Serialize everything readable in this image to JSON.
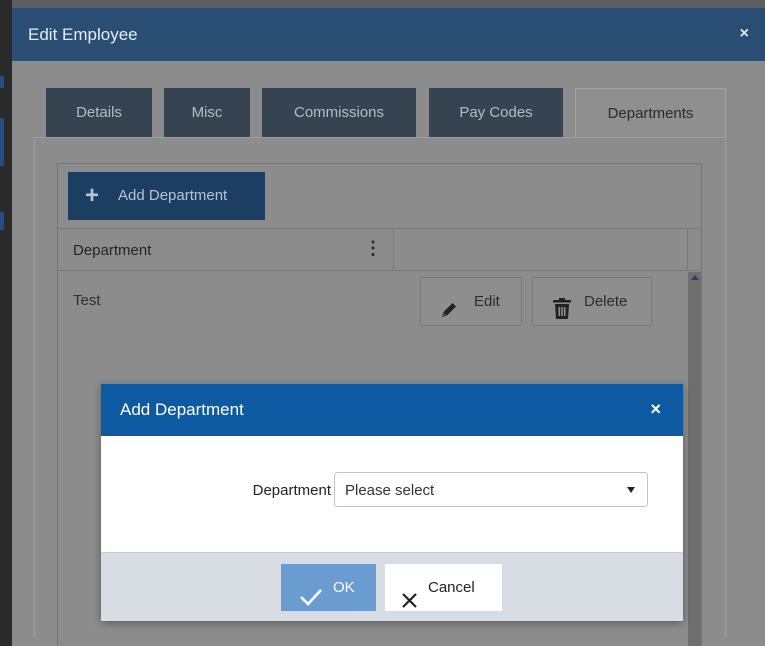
{
  "outer_dialog": {
    "title": "Edit Employee",
    "close_glyph": "×",
    "tabs": [
      {
        "label": "Details",
        "active": false
      },
      {
        "label": "Misc",
        "active": false
      },
      {
        "label": "Commissions",
        "active": false
      },
      {
        "label": "Pay Codes",
        "active": false
      },
      {
        "label": "Departments",
        "active": true
      }
    ]
  },
  "toolbar": {
    "add_label": "Add Department",
    "add_icon": "plus-icon"
  },
  "table": {
    "columns": [
      {
        "label": "Department",
        "has_menu": true
      },
      {
        "label": ""
      }
    ],
    "column_menu_glyph": "⋮",
    "rows": [
      {
        "department": "Test",
        "actions": [
          {
            "label": "Edit",
            "icon": "pencil-icon"
          },
          {
            "label": "Delete",
            "icon": "trash-icon"
          }
        ]
      }
    ]
  },
  "modal": {
    "title": "Add Department",
    "close_glyph": "×",
    "field": {
      "label": "Department",
      "required": true,
      "value": "Please select"
    },
    "ok_label": "OK",
    "cancel_label": "Cancel"
  },
  "colors": {
    "outer_header": "#2a4d73",
    "modal_header": "#0d5aa2",
    "required_dot": "#d23030",
    "ok_button": "#6a9cd1"
  }
}
